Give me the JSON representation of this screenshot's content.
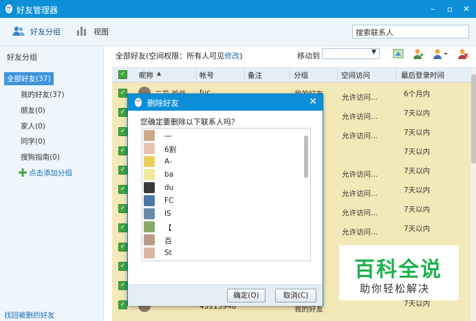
{
  "window": {
    "title": "好友管理器",
    "controls": [
      "–",
      "▫",
      "✕"
    ]
  },
  "toolbar": {
    "friend_groups": "好友分组",
    "view": "视图",
    "search_placeholder": "搜索联系人"
  },
  "sidebar": {
    "title": "好友分组",
    "items": [
      {
        "label": "全部好友(37)",
        "active": true
      },
      {
        "label": "我的好友(37)"
      },
      {
        "label": "朋友(0)"
      },
      {
        "label": "家人(0)"
      },
      {
        "label": "同学(0)"
      },
      {
        "label": "搜狗指南(0)"
      }
    ],
    "add_group": "点击添加分组",
    "find_deleted": "找回被删的好友"
  },
  "main": {
    "header_prefix": "全部好友(空间权限：所有人可见",
    "header_link": "修改",
    "header_suffix": ")",
    "move_to": "移动到"
  },
  "table": {
    "columns": [
      "昵称",
      "帐号",
      "备注",
      "分组",
      "空间访问",
      "最后登录时间"
    ],
    "rows": [
      {
        "nick": "二花 爸爸",
        "acct": "fuc...",
        "note": "",
        "group": "我的好友",
        "space": "允许访问...",
        "last": "6个月内"
      },
      {
        "nick": "",
        "acct": "",
        "note": "",
        "group": "",
        "space": "允许访问...",
        "last": "7天以内"
      },
      {
        "nick": "",
        "acct": "",
        "note": "",
        "group": "",
        "space": "允许访问...",
        "last": "7天以内"
      },
      {
        "nick": "",
        "acct": "",
        "note": "",
        "group": "",
        "space": "",
        "last": "7天以内"
      },
      {
        "nick": "",
        "acct": "",
        "note": "",
        "group": "",
        "space": "允许访问...",
        "last": "7天以内"
      },
      {
        "nick": "",
        "acct": "",
        "note": "",
        "group": "",
        "space": "允许访问...",
        "last": "7天以内"
      },
      {
        "nick": "",
        "acct": "",
        "note": "",
        "group": "",
        "space": "允许访问...",
        "last": "7天以内"
      },
      {
        "nick": "",
        "acct": "",
        "note": "",
        "group": "",
        "space": "允许访问...",
        "last": "7天以内"
      },
      {
        "nick": "",
        "acct": "",
        "note": "",
        "group": "",
        "space": "",
        "last": ""
      },
      {
        "nick": "",
        "acct": "",
        "note": "",
        "group": "",
        "space": "",
        "last": ""
      },
      {
        "nick": "",
        "acct": "",
        "note": "",
        "group": "",
        "space": "",
        "last": ""
      },
      {
        "nick": "",
        "acct": "45113948",
        "note": "",
        "group": "我的好友",
        "space": "",
        "last": "7天以内"
      }
    ]
  },
  "dialog": {
    "title": "删除好友",
    "question": "您确定要删除以下联系人吗？",
    "list": [
      "一",
      "6割",
      "A-",
      "ba",
      "du",
      "FC",
      "IS",
      "【",
      "百",
      "St"
    ],
    "ok": "确定(O)",
    "cancel": "取消(C)"
  },
  "watermark": {
    "big": "百科全说",
    "small": "助你轻松解决"
  },
  "colors": {
    "titlebar": "#0c8fd8",
    "row_highlight": "#f3e9b8",
    "check_green": "#40a540",
    "watermark_green": "#1cb24c"
  }
}
